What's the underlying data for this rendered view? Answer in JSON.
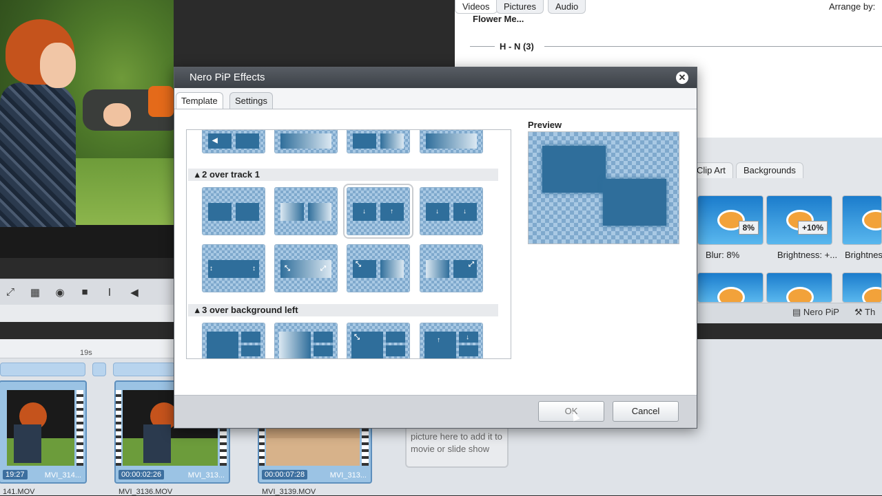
{
  "library": {
    "tabs": [
      "Videos",
      "Pictures",
      "Audio"
    ],
    "arrange_label": "Arrange by:",
    "folder_title": "Flower Me...",
    "group_title": "H - N (3)"
  },
  "effects": {
    "tabs": [
      "Clip Art",
      "Backgrounds"
    ],
    "items": [
      {
        "badge": "8%",
        "label": "Blur: 8%"
      },
      {
        "badge": "+10%",
        "label": "Brightness: +..."
      },
      {
        "badge": "",
        "label": "Brightnes"
      }
    ],
    "nero_pip_label": "Nero PiP",
    "th_label": "Th"
  },
  "timeline": {
    "ruler_time": "19s",
    "clips": [
      {
        "time": "19:27",
        "name": "MVI_314...",
        "file": "141.MOV"
      },
      {
        "time": "00:00:02:26",
        "name": "MVI_313...",
        "file": "MVI_3136.MOV"
      },
      {
        "time": "00:00:07:28",
        "name": "MVI_313...",
        "file": "MVI_3139.MOV"
      }
    ],
    "dropzone_text": "picture here to add it to movie or slide show"
  },
  "dialog": {
    "title": "Nero PiP Effects",
    "close_glyph": "✕",
    "tabs": [
      "Template",
      "Settings"
    ],
    "sections": [
      "2 over track 1",
      "3 over background left"
    ],
    "preview_label": "Preview",
    "ok_label": "OK",
    "cancel_label": "Cancel"
  },
  "icons": [
    "camera-icon",
    "stop-icon",
    "split-icon",
    "step-back-icon",
    "crop-icon",
    "grid-icon",
    "close-icon",
    "nero-pip-icon",
    "wand-icon"
  ],
  "colors": {
    "accent_blue": "#2f6e9b",
    "dialog_title": "#3c4147",
    "clip_blue": "#9bc3e4"
  }
}
